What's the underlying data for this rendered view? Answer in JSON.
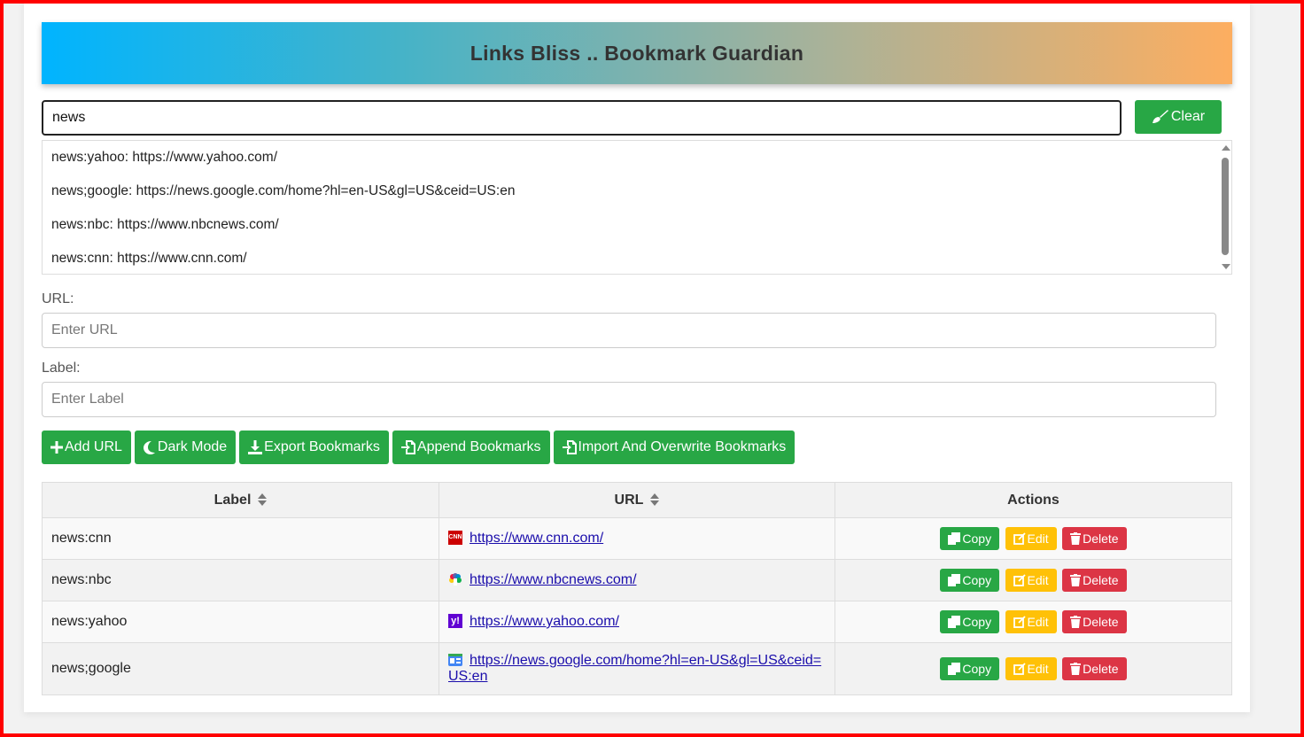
{
  "app": {
    "title": "Links Bliss .. Bookmark Guardian"
  },
  "search": {
    "value": "news",
    "clear_label": "Clear"
  },
  "results": [
    "news:yahoo: https://www.yahoo.com/",
    "news;google: https://news.google.com/home?hl=en-US&gl=US&ceid=US:en",
    "news:nbc: https://www.nbcnews.com/",
    "news:cnn: https://www.cnn.com/"
  ],
  "form": {
    "url_label": "URL:",
    "url_placeholder": "Enter URL",
    "label_label": "Label:",
    "label_placeholder": "Enter Label"
  },
  "toolbar": {
    "add_url": "Add URL",
    "dark_mode": "Dark Mode",
    "export": "Export Bookmarks",
    "append": "Append Bookmarks",
    "import_overwrite": "Import And Overwrite Bookmarks"
  },
  "table": {
    "headers": {
      "label": "Label",
      "url": "URL",
      "actions": "Actions"
    },
    "rows": [
      {
        "label": "news:cnn",
        "url": "https://www.cnn.com/",
        "favicon": "cnn-icon"
      },
      {
        "label": "news:nbc",
        "url": "https://www.nbcnews.com/",
        "favicon": "nbc-peacock-icon"
      },
      {
        "label": "news:yahoo",
        "url": "https://www.yahoo.com/",
        "favicon": "yahoo-icon"
      },
      {
        "label": "news;google",
        "url": "https://news.google.com/home?hl=en-US&gl=US&ceid=US:en",
        "favicon": "google-news-icon"
      }
    ],
    "actions": {
      "copy": "Copy",
      "edit": "Edit",
      "delete": "Delete"
    }
  },
  "colors": {
    "primary_green": "#28a745",
    "edit_yellow": "#ffc107",
    "delete_red": "#dc3545",
    "link": "#1a0dab"
  }
}
